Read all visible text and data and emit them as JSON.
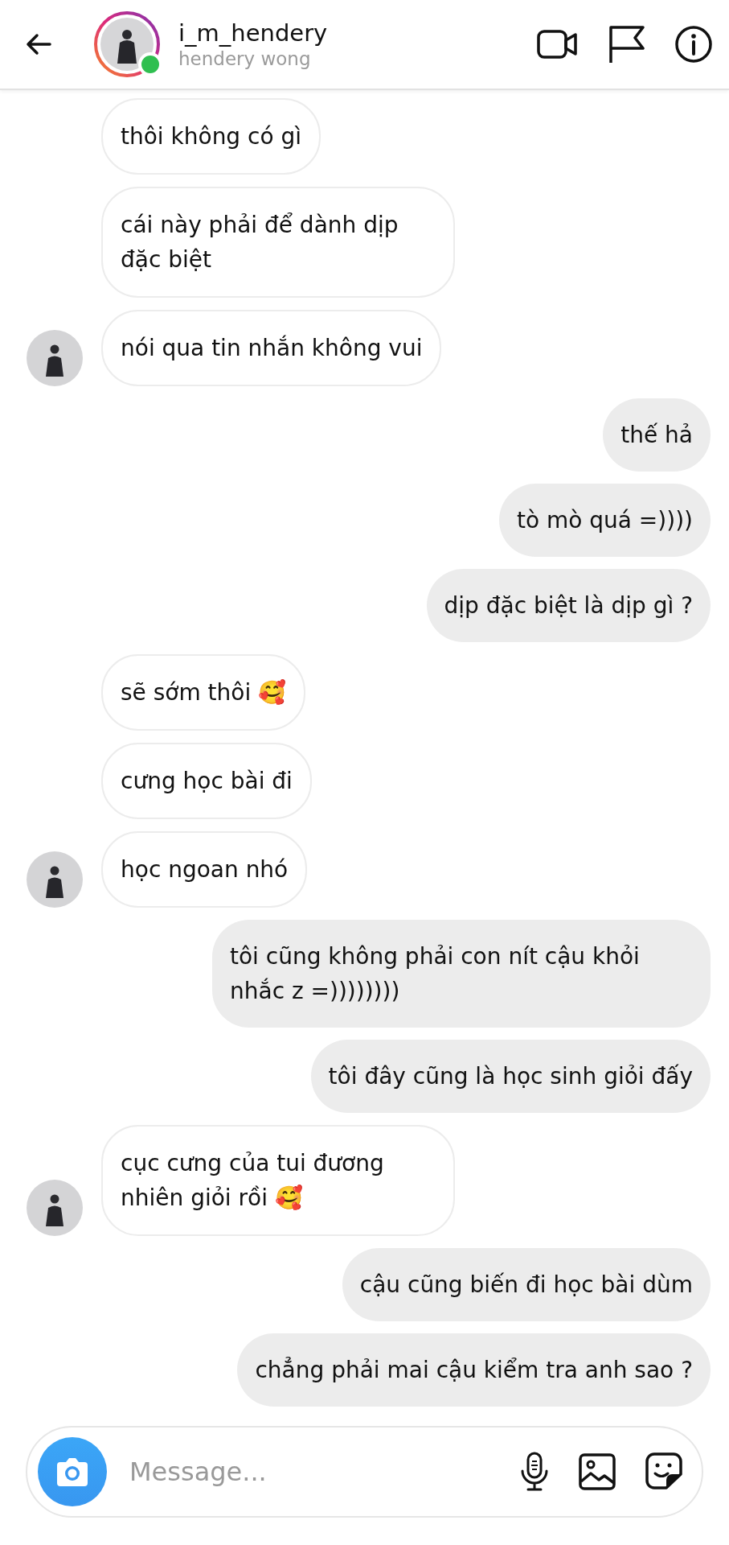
{
  "header": {
    "username": "i_m_hendery",
    "subtitle": "hendery wong",
    "online": true
  },
  "messages": [
    {
      "kind": "incoming",
      "text": "thôi không có gì",
      "show_avatar": false
    },
    {
      "kind": "incoming",
      "text": "cái này phải để dành dịp đặc biệt",
      "show_avatar": false
    },
    {
      "kind": "incoming",
      "text": "nói qua tin nhắn không vui",
      "show_avatar": true
    },
    {
      "kind": "outgoing",
      "text": "thế hả",
      "show_avatar": false
    },
    {
      "kind": "outgoing",
      "text": "tò mò quá =))))",
      "show_avatar": false
    },
    {
      "kind": "outgoing",
      "text": "dịp đặc biệt là dịp gì ?",
      "show_avatar": false
    },
    {
      "kind": "incoming",
      "text": "sẽ sớm thôi 🥰",
      "show_avatar": false
    },
    {
      "kind": "incoming",
      "text": "cưng học bài đi",
      "show_avatar": false
    },
    {
      "kind": "incoming",
      "text": "học ngoan nhó",
      "show_avatar": true
    },
    {
      "kind": "outgoing",
      "text": "tôi cũng không phải con nít cậu khỏi nhắc z =))))))))",
      "show_avatar": false
    },
    {
      "kind": "outgoing",
      "text": "tôi đây cũng là học sinh giỏi đấy",
      "show_avatar": false
    },
    {
      "kind": "incoming",
      "text": "cục cưng của tui đương nhiên giỏi rồi 🥰",
      "show_avatar": true
    },
    {
      "kind": "outgoing",
      "text": "cậu cũng biến đi học bài dùm",
      "show_avatar": false
    },
    {
      "kind": "outgoing",
      "text": "chẳng phải mai cậu kiểm tra anh sao ?",
      "show_avatar": false
    }
  ],
  "composer": {
    "placeholder": "Message..."
  }
}
